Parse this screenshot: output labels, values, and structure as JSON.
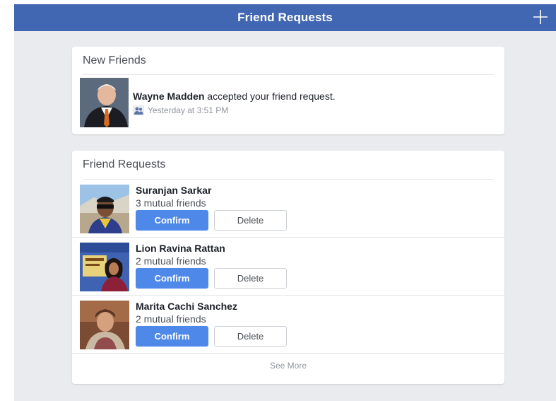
{
  "navbar": {
    "title": "Friend Requests",
    "add_icon": "plus-icon"
  },
  "new_friends": {
    "header": "New Friends",
    "item": {
      "name": "Wayne Madden",
      "action": " accepted your friend request.",
      "time": "Yesterday at 3:51 PM",
      "icon": "friends-icon"
    }
  },
  "friend_requests": {
    "header": "Friend Requests",
    "items": [
      {
        "name": "Suranjan Sarkar",
        "mutual": "3 mutual friends",
        "confirm": "Confirm",
        "delete": "Delete"
      },
      {
        "name": "Lion Ravina Rattan",
        "mutual": "2 mutual friends",
        "confirm": "Confirm",
        "delete": "Delete"
      },
      {
        "name": "Marita Cachi Sanchez",
        "mutual": "2 mutual friends",
        "confirm": "Confirm",
        "delete": "Delete"
      }
    ],
    "see_more": "See More"
  },
  "colors": {
    "navbar": "#4267b2",
    "confirm_button": "#4e88e8",
    "background": "#e9ebee"
  }
}
